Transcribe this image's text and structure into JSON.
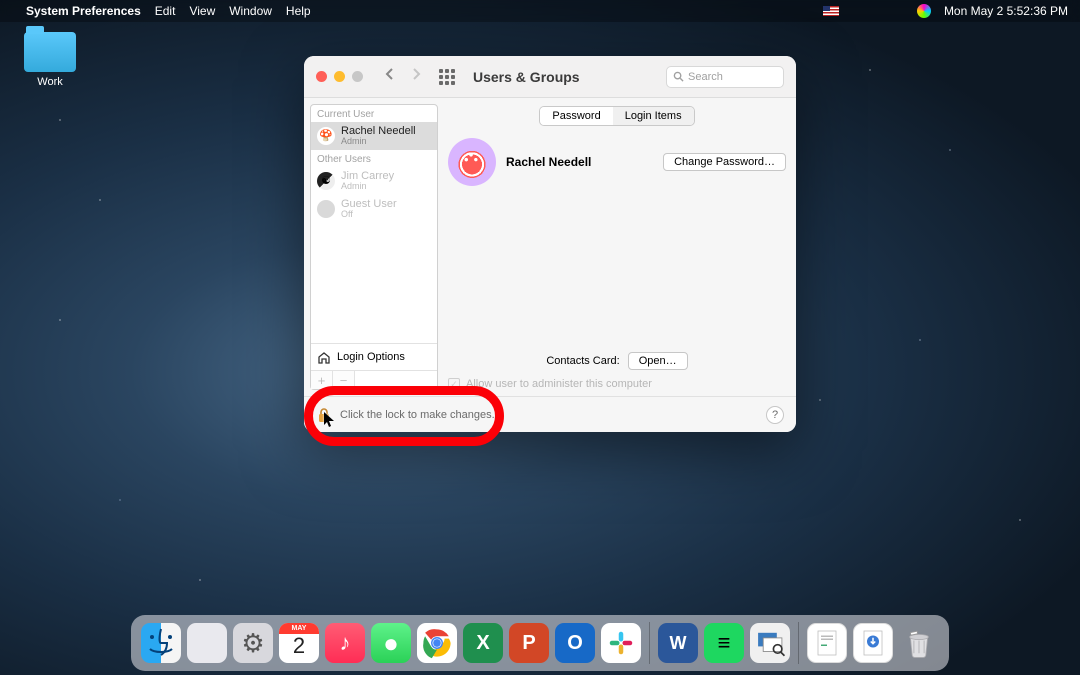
{
  "menubar": {
    "app": "System Preferences",
    "items": [
      "Edit",
      "View",
      "Window",
      "Help"
    ],
    "clock": "Mon May 2  5:52:36 PM"
  },
  "desktop": {
    "folder_label": "Work"
  },
  "window": {
    "title": "Users & Groups",
    "search_placeholder": "Search",
    "sidebar": {
      "current_label": "Current User",
      "other_label": "Other Users",
      "current": {
        "name": "Rachel Needell",
        "role": "Admin"
      },
      "others": [
        {
          "name": "Jim Carrey",
          "role": "Admin"
        },
        {
          "name": "Guest User",
          "role": "Off"
        }
      ],
      "login_options": "Login Options"
    },
    "tabs": {
      "password": "Password",
      "login_items": "Login Items"
    },
    "user": {
      "name": "Rachel Needell"
    },
    "change_password": "Change Password…",
    "contacts_label": "Contacts Card:",
    "open": "Open…",
    "admin_check": "Allow user to administer this computer",
    "lock_text": "Click the lock to make changes.",
    "help": "?"
  },
  "dock": {
    "cal_month": "MAY",
    "cal_day": "2"
  }
}
